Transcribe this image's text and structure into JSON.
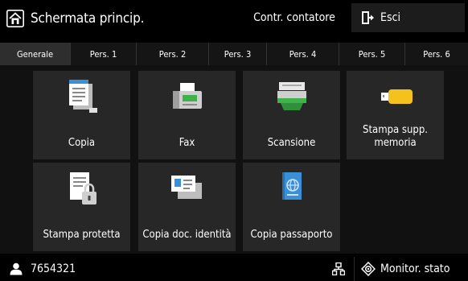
{
  "header": {
    "title": "Schermata princip.",
    "counter_label": "Contr. contatore",
    "logout_label": "Esci"
  },
  "tabs": [
    {
      "label": "Generale",
      "active": true
    },
    {
      "label": "Pers. 1"
    },
    {
      "label": "Pers. 2"
    },
    {
      "label": "Pers. 3"
    },
    {
      "label": "Pers. 4"
    },
    {
      "label": "Pers. 5"
    },
    {
      "label": "Pers. 6"
    }
  ],
  "tiles": [
    {
      "label": "Copia",
      "icon": "copy-icon"
    },
    {
      "label": "Fax",
      "icon": "fax-icon"
    },
    {
      "label": "Scansione",
      "icon": "scan-icon"
    },
    {
      "label": "Stampa supp. memoria",
      "icon": "usb-memory-icon"
    },
    {
      "label": "Stampa protetta",
      "icon": "secure-print-icon"
    },
    {
      "label": "Copia doc. identità",
      "icon": "id-card-copy-icon"
    },
    {
      "label": "Copia passaporto",
      "icon": "passport-copy-icon"
    }
  ],
  "footer": {
    "user_id": "7654321",
    "monitor_label": "Monitor. stato"
  },
  "colors": {
    "background": "#000000",
    "tile": "#272727",
    "accent_green": "#3fb24a",
    "accent_yellow": "#f5c21b",
    "accent_blue": "#3a8fd9"
  }
}
